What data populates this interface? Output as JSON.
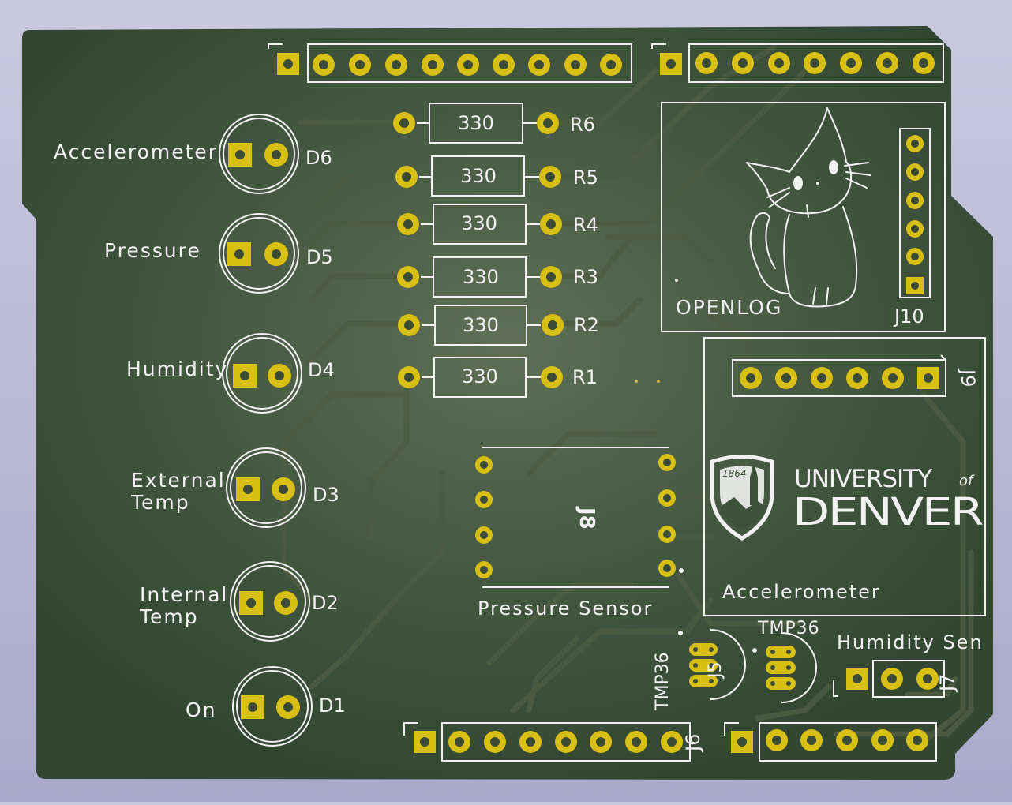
{
  "colors": {
    "background": "#b8b8d4",
    "board": "#384a37",
    "silkscreen": "#f2f2f2",
    "copper_pad": "#d8bf14",
    "trace": "#4b5a3f"
  },
  "led_labels": [
    "Accelerometer",
    "Pressure",
    "Humidity",
    "External",
    "Temp",
    "Internal",
    "Temp",
    "On"
  ],
  "led_refs": [
    "D6",
    "D5",
    "D4",
    "D3",
    "D2",
    "D1"
  ],
  "resistor_value": "330",
  "resistor_refs": [
    "R6",
    "R5",
    "R4",
    "R3",
    "R2",
    "R1"
  ],
  "openlog": {
    "label": "OPENLOG",
    "ref": "J10",
    "icon": "cat-icon"
  },
  "accelerometer": {
    "label": "Accelerometer",
    "ref": "J9"
  },
  "pressure": {
    "label": "Pressure Sensor",
    "ref": "J8"
  },
  "logo": {
    "year": "1864",
    "line1": "UNIVERSITY",
    "of": "of",
    "line2": "DENVER",
    "icon": "university-shield-icon"
  },
  "tmp36": {
    "label": "TMP36",
    "ref": "J5"
  },
  "tmp36_b": {
    "label": "TMP36"
  },
  "humidity": {
    "label": "Humidity Sen",
    "ref": "J7"
  },
  "header_bottom_left": {
    "ref": "J6"
  }
}
